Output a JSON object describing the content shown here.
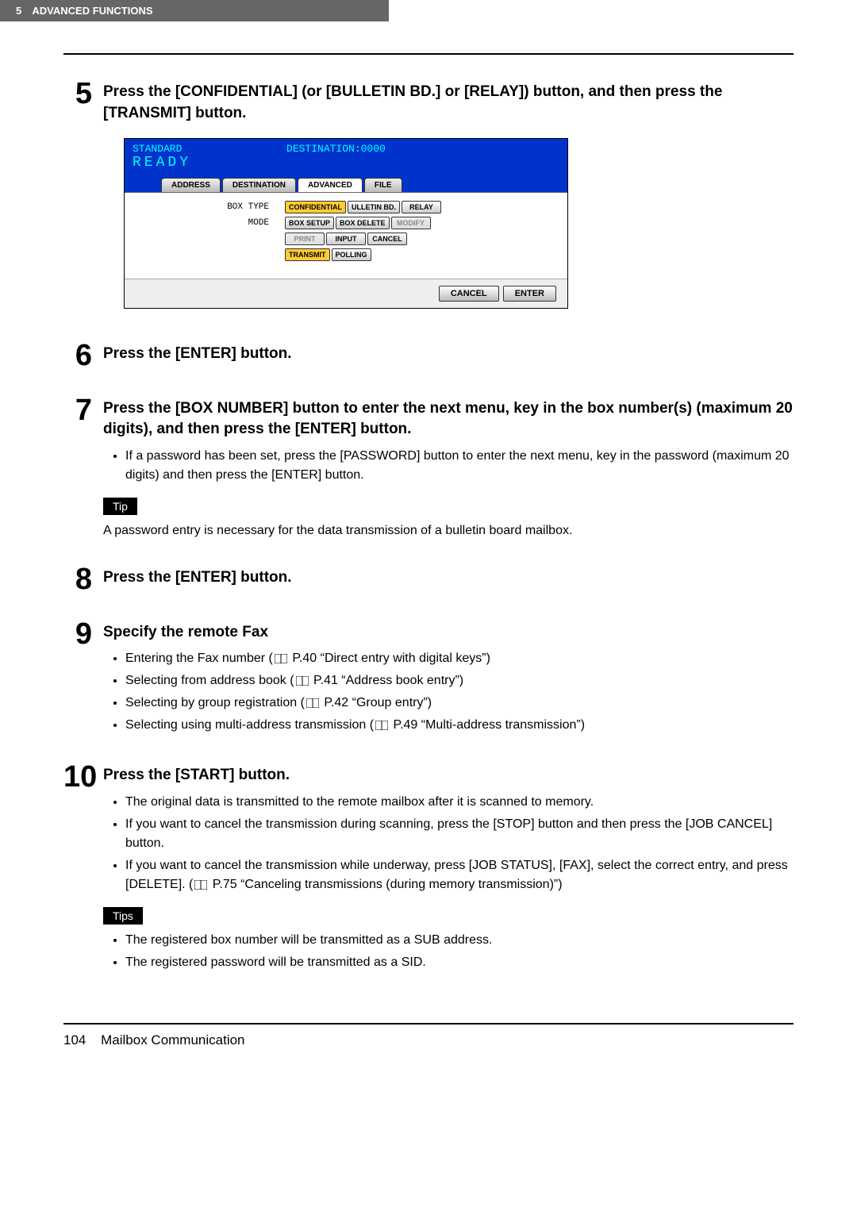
{
  "header": {
    "chapter_num": "5",
    "chapter_title": "ADVANCED FUNCTIONS"
  },
  "steps": {
    "s5": {
      "num": "5",
      "title": "Press the [CONFIDENTIAL] (or [BULLETIN BD.] or [RELAY]) button, and then press the [TRANSMIT] button."
    },
    "s6": {
      "num": "6",
      "title": "Press the [ENTER] button."
    },
    "s7": {
      "num": "7",
      "title": "Press the [BOX NUMBER] button to enter the next menu, key in the box number(s) (maximum 20 digits), and then press the [ENTER] button.",
      "bullet1": "If a password has been set, press the [PASSWORD] button to enter the next menu, key in the password (maximum 20 digits) and then press the [ENTER] button.",
      "tip_label": "Tip",
      "tip_text": "A password entry is necessary for the data transmission of a bulletin board mailbox."
    },
    "s8": {
      "num": "8",
      "title": "Press the [ENTER] button."
    },
    "s9": {
      "num": "9",
      "title": "Specify the remote Fax",
      "b1a": "Entering the Fax number (",
      "b1b": " P.40 “Direct entry with digital keys”)",
      "b2a": "Selecting from address book (",
      "b2b": " P.41 “Address book entry”)",
      "b3a": "Selecting by group registration (",
      "b3b": " P.42 “Group entry”)",
      "b4a": "Selecting using multi-address transmission (",
      "b4b": " P.49 “Multi-address transmission”)"
    },
    "s10": {
      "num": "10",
      "title": "Press the [START] button.",
      "b1": "The original data is transmitted to the remote mailbox after it is scanned to memory.",
      "b2": "If you want to cancel the transmission during scanning, press the [STOP] button and then press the [JOB CANCEL] button.",
      "b3a": "If you want to cancel the transmission while underway, press [JOB STATUS], [FAX], select the correct entry, and press [DELETE]. (",
      "b3b": " P.75 “Canceling transmissions (during memory transmission)”)",
      "tips_label": "Tips",
      "tip1": "The registered box number will be transmitted as a SUB address.",
      "tip2": "The registered password will be transmitted as a SID."
    }
  },
  "screenshot": {
    "standard": "STANDARD",
    "destination": "DESTINATION:0000",
    "ready": "READY",
    "tabs": {
      "address": "ADDRESS",
      "dest": "DESTINATION",
      "advanced": "ADVANCED",
      "file": "FILE"
    },
    "labels": {
      "box_type": "BOX TYPE",
      "mode": "MODE"
    },
    "buttons": {
      "confidential": "CONFIDENTIAL",
      "bulletin": "ULLETIN BD.",
      "relay": "RELAY",
      "box_setup": "BOX SETUP",
      "box_delete": "BOX DELETE",
      "modify": "MODIFY",
      "print": "PRINT",
      "input": "INPUT",
      "cancel_small": "CANCEL",
      "transmit": "TRANSMIT",
      "polling": "POLLING",
      "cancel": "CANCEL",
      "enter": "ENTER"
    }
  },
  "footer": {
    "page": "104",
    "section": "Mailbox Communication"
  }
}
